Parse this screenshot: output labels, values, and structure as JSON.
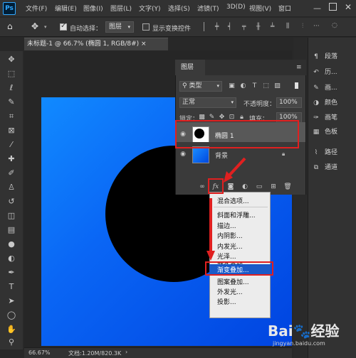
{
  "app": {
    "logo": "Ps"
  },
  "menubar": {
    "items": [
      "文件(F)",
      "编辑(E)",
      "图像(I)",
      "图层(L)",
      "文字(Y)",
      "选择(S)",
      "滤镜(T)",
      "3D(D)",
      "视图(V)",
      "窗口"
    ]
  },
  "options": {
    "auto_select_label": "自动选择：",
    "auto_select_value": "图层",
    "transform_label": "显示变换控件"
  },
  "document": {
    "tab_title": "未标题-1 @ 66.7% (椭圆 1, RGB/8#) ×",
    "zoom": "66.67%",
    "doc_info": "文档:1.20M/820.3K"
  },
  "dock": {
    "items": [
      "段落",
      "历...",
      "画...",
      "颜色",
      "画笔",
      "色板",
      "路径",
      "通道"
    ]
  },
  "layers": {
    "tab_label": "图层",
    "filter_value": "类型",
    "blend_mode": "正常",
    "opacity_label": "不透明度：",
    "opacity_value": "100%",
    "lock_label": "锁定：",
    "fill_label": "填充：",
    "fill_value": "100%",
    "items": [
      {
        "name": "椭圆 1"
      },
      {
        "name": "背景"
      }
    ],
    "fx_label": "fx"
  },
  "fx_menu": {
    "items": [
      "混合选项...",
      "斜面和浮雕...",
      "描边...",
      "内阴影...",
      "内发光...",
      "光泽...",
      "颜色叠加...",
      "渐变叠加...",
      "图案叠加...",
      "外发光...",
      "投影..."
    ]
  },
  "watermark": {
    "main": "Bai🐾经验",
    "sub": "jingyan.baidu.com"
  },
  "colors": {
    "accent_red": "#e02020",
    "highlight_blue": "#1a5ac8"
  }
}
